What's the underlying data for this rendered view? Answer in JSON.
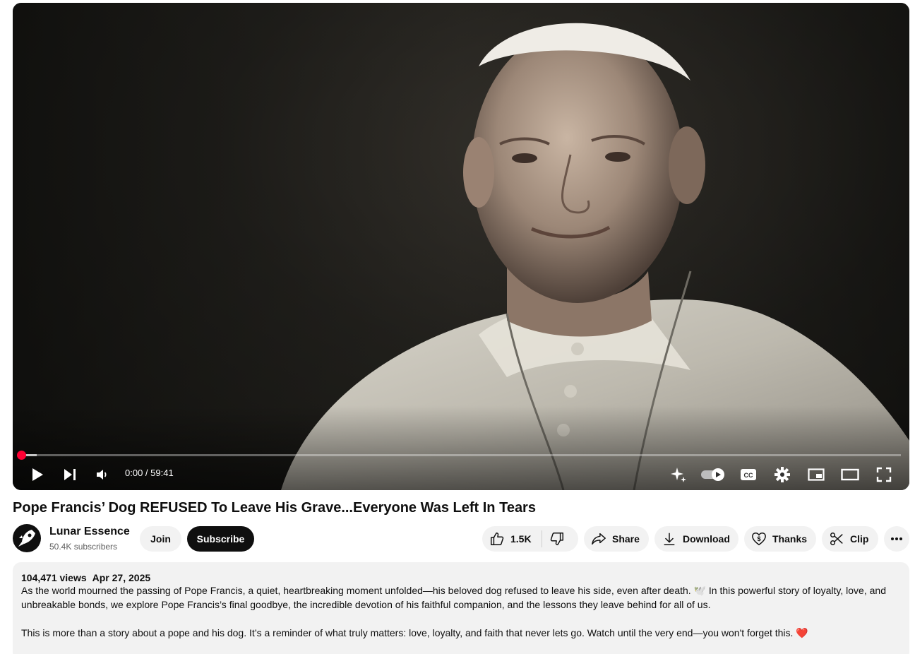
{
  "player": {
    "time": "0:00 / 59:41",
    "progress": 0,
    "icons": [
      "play-icon",
      "next-icon",
      "volume-icon",
      "ambient-sparkle-icon",
      "autoplay-toggle-icon",
      "captions-icon",
      "settings-icon",
      "miniplayer-icon",
      "theater-mode-icon",
      "fullscreen-icon"
    ]
  },
  "video": {
    "title": "Pope Francis’ Dog REFUSED To Leave His Grave...Everyone Was Left In Tears"
  },
  "channel": {
    "name": "Lunar Essence",
    "subscribers": "50.4K subscribers",
    "join_label": "Join",
    "subscribe_label": "Subscribe"
  },
  "actions": {
    "likes": "1.5K",
    "share_label": "Share",
    "download_label": "Download",
    "thanks_label": "Thanks",
    "clip_label": "Clip"
  },
  "description": {
    "views": "104,471 views",
    "date": "Apr 27, 2025",
    "paragraph1": "As the world mourned the passing of Pope Francis, a quiet, heartbreaking moment unfolded—his beloved dog refused to leave his side, even after death. 🕊️ In this powerful story of loyalty, love, and unbreakable bonds, we explore Pope Francis’s final goodbye, the incredible devotion of his faithful companion, and the lessons they leave behind for all of us.",
    "paragraph2": "This is more than a story about a pope and his dog. It’s a reminder of what truly matters: love, loyalty, and faith that never lets go. Watch until the very end—you won't forget this. ❤️"
  },
  "colors": {
    "accent": "#ff0033",
    "subscribe_bg": "#0f0f0f",
    "pill_bg": "#f2f2f2"
  }
}
